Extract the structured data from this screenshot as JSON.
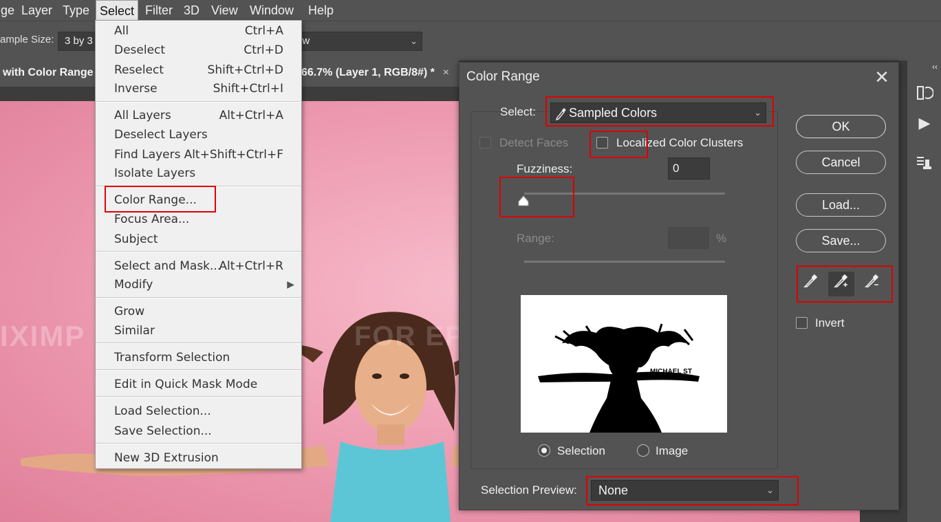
{
  "menubar": {
    "items": [
      "ge",
      "Layer",
      "Type",
      "Select",
      "Filter",
      "3D",
      "View",
      "Window",
      "Help"
    ],
    "active": "Select"
  },
  "options": {
    "sample_size_label": "ample Size:",
    "sample_size_value": "3 by 3",
    "show_value": "ow"
  },
  "tabs": {
    "left_title": "with Color Range",
    "right_title": "66.7% (Layer 1, RGB/8#) *",
    "close": "×"
  },
  "canvas": {
    "watermark_left": "IXIMP",
    "watermark_right": "FOR EP"
  },
  "select_menu": {
    "groups": [
      [
        {
          "label": "All",
          "shortcut": "Ctrl+A"
        },
        {
          "label": "Deselect",
          "shortcut": "Ctrl+D"
        },
        {
          "label": "Reselect",
          "shortcut": "Shift+Ctrl+D"
        },
        {
          "label": "Inverse",
          "shortcut": "Shift+Ctrl+I"
        }
      ],
      [
        {
          "label": "All Layers",
          "shortcut": "Alt+Ctrl+A"
        },
        {
          "label": "Deselect Layers",
          "shortcut": ""
        },
        {
          "label": "Find Layers",
          "shortcut": "Alt+Shift+Ctrl+F"
        },
        {
          "label": "Isolate Layers",
          "shortcut": ""
        }
      ],
      [
        {
          "label": "Color Range...",
          "shortcut": ""
        },
        {
          "label": "Focus Area...",
          "shortcut": ""
        },
        {
          "label": "Subject",
          "shortcut": ""
        }
      ],
      [
        {
          "label": "Select and Mask...",
          "shortcut": "Alt+Ctrl+R"
        },
        {
          "label": "Modify",
          "shortcut": ""
        }
      ],
      [
        {
          "label": "Grow",
          "shortcut": ""
        },
        {
          "label": "Similar",
          "shortcut": ""
        }
      ],
      [
        {
          "label": "Transform Selection",
          "shortcut": ""
        }
      ],
      [
        {
          "label": "Edit in Quick Mask Mode",
          "shortcut": ""
        }
      ],
      [
        {
          "label": "Load Selection...",
          "shortcut": ""
        },
        {
          "label": "Save Selection...",
          "shortcut": ""
        }
      ],
      [
        {
          "label": "New 3D Extrusion",
          "shortcut": ""
        }
      ]
    ],
    "submenu_arrow": "▶"
  },
  "dialog": {
    "title": "Color Range",
    "close": "✕",
    "select_label": "Select:",
    "select_value": "Sampled Colors",
    "detect_faces": "Detect Faces",
    "localized_clusters": "Localized Color Clusters",
    "fuzziness_label": "Fuzziness:",
    "fuzziness_value": "0",
    "range_label": "Range:",
    "range_unit": "%",
    "preview_option_selection": "Selection",
    "preview_option_image": "Image",
    "selection_preview_label": "Selection Preview:",
    "selection_preview_value": "None",
    "ok": "OK",
    "cancel": "Cancel",
    "load": "Load...",
    "save": "Save...",
    "invert": "Invert",
    "preview_text": "MICHAEL ST",
    "fuzziness_level": 0
  },
  "colors": {
    "highlight": "#e00000",
    "panel": "#535353",
    "menu_bg": "#f0f0f0"
  },
  "icons": {
    "eyedropper": "eyedropper-icon",
    "eyedropper_add": "eyedropper-plus-icon",
    "eyedropper_subtract": "eyedropper-minus-icon"
  }
}
